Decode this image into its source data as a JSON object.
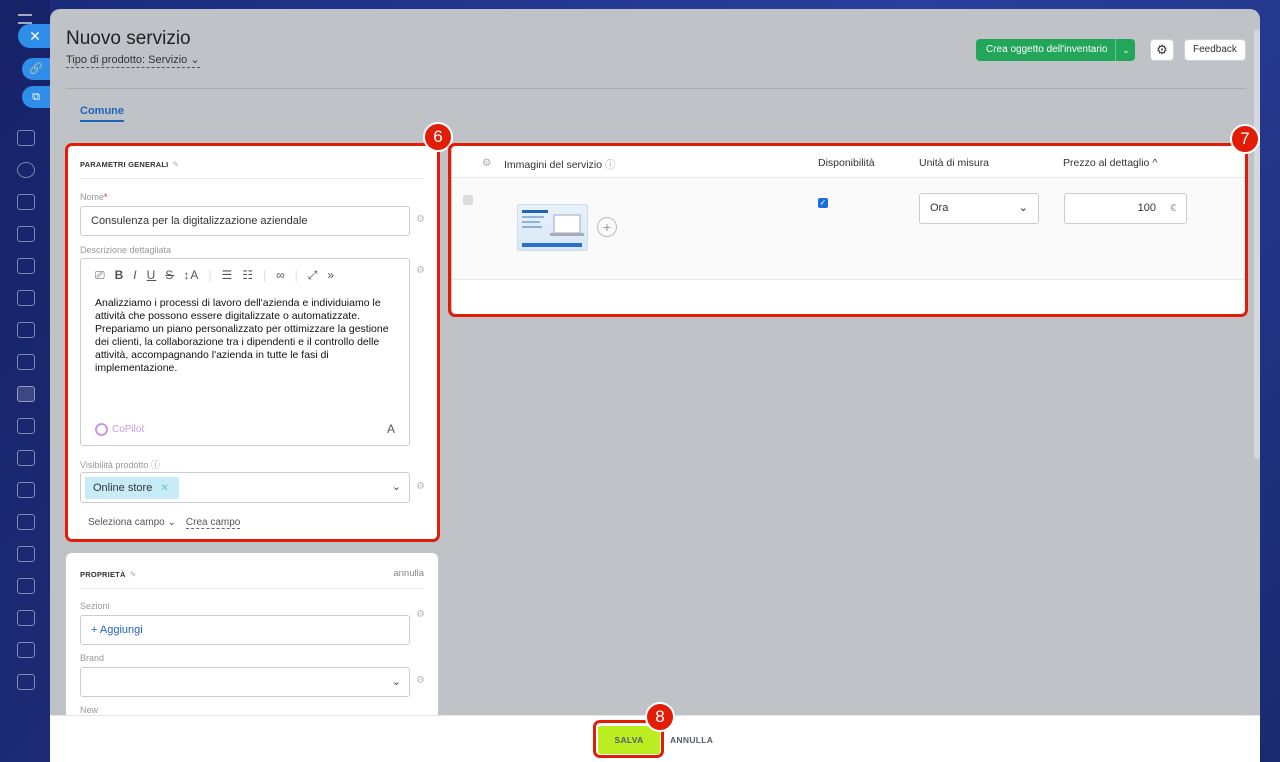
{
  "header": {
    "title": "Nuovo servizio",
    "product_type": "Tipo di prodotto: Servizio",
    "create_inventory_btn": "Crea oggetto dell'inventario",
    "feedback_btn": "Feedback"
  },
  "tabs": {
    "common": "Comune"
  },
  "general": {
    "title": "PARAMETRI GENERALI",
    "name_label": "Nome",
    "name_required": "*",
    "name_value": "Consulenza per la digitalizzazione aziendale",
    "desc_label": "Descrizione dettagliata",
    "desc_text": "Analizziamo i processi di lavoro dell'azienda e individuiamo le attività che possono essere digitalizzate o automatizzate. Prepariamo un piano personalizzato per ottimizzare la gestione dei clienti, la collaborazione tra i dipendenti e il controllo delle attività, accompagnando l'azienda in tutte le fasi di implementazione.",
    "copilot": "CoPilot",
    "font_btn": "A",
    "visibility_label": "Visibilità prodotto",
    "visibility_tag": "Online store",
    "select_field": "Seleziona campo",
    "create_field": "Crea campo"
  },
  "toolbar": {
    "bold": "B",
    "italic": "I",
    "underline": "U",
    "strike": "S",
    "size": "↕A",
    "more": "»"
  },
  "properties": {
    "title": "PROPRIETÀ",
    "cancel": "annulla",
    "sections_label": "Sezioni",
    "sections_add": "+ Aggiungi",
    "brand_label": "Brand",
    "new_label": "New"
  },
  "grid": {
    "col_images": "Immagini del servizio",
    "col_availability": "Disponibilità",
    "col_unit": "Unità di misura",
    "col_price": "Prezzo al dettaglio",
    "sort_icon": "^",
    "unit_value": "Ora",
    "price_value": "100",
    "currency": "€",
    "available": true
  },
  "annotations": {
    "general": "6",
    "grid": "7",
    "save": "8"
  },
  "footer": {
    "save": "SALVA",
    "cancel": "ANNULLA"
  },
  "colors": {
    "accent": "#1b64b8",
    "green": "#21a65a",
    "highlight": "#e11d07",
    "save": "#bbed21"
  }
}
